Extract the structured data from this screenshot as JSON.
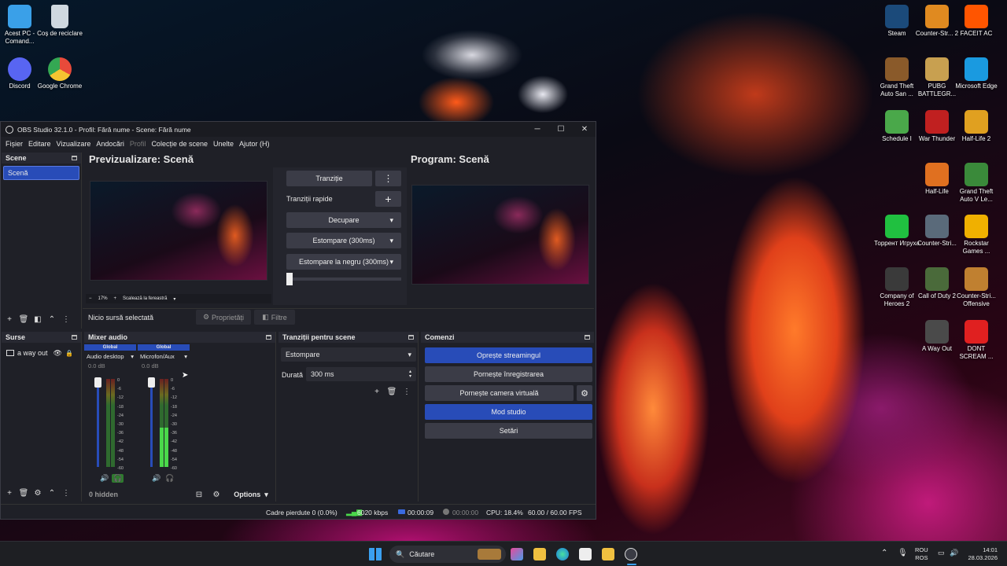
{
  "desktop": {
    "left_icons": [
      {
        "label": "Acest PC - Comand...",
        "icon": "monitor-icon",
        "color": "#3aa0e8"
      },
      {
        "label": "Coș de reciclare",
        "icon": "recycle-bin-icon",
        "color": "#cfd8e0"
      },
      {
        "label": "Discord",
        "icon": "discord-icon",
        "color": "#5865f2"
      },
      {
        "label": "Google Chrome",
        "icon": "chrome-icon",
        "color": "#e84a3a"
      }
    ],
    "right_icons": [
      {
        "label": "Steam",
        "icon": "steam-icon",
        "color": "#1b4a7a"
      },
      {
        "label": "Counter-Str... 2",
        "icon": "cs2-icon",
        "color": "#e08a20"
      },
      {
        "label": "FACEIT AC",
        "icon": "faceit-icon",
        "color": "#ff5500"
      },
      {
        "label": "Grand Theft Auto San ...",
        "icon": "gta-sa-icon",
        "color": "#8a5a2a"
      },
      {
        "label": "PUBG BATTLEGR...",
        "icon": "pubg-icon",
        "color": "#c8a050"
      },
      {
        "label": "Microsoft Edge",
        "icon": "edge-icon",
        "color": "#1a9ae0"
      },
      {
        "label": "Schedule I",
        "icon": "schedule-icon",
        "color": "#4aa84a"
      },
      {
        "label": "War Thunder",
        "icon": "war-thunder-icon",
        "color": "#c02020"
      },
      {
        "label": "Half-Life 2",
        "icon": "half-life-2-icon",
        "color": "#e0a020"
      },
      {
        "label": "Half-Life",
        "icon": "half-life-icon",
        "color": "#e07020"
      },
      {
        "label": "Grand Theft Auto V Le...",
        "icon": "gta-v-icon",
        "color": "#3a8a3a"
      },
      {
        "label": "Торрент Игруха",
        "icon": "torrent-icon",
        "color": "#20c040"
      },
      {
        "label": "Counter-Stri...",
        "icon": "cs-icon",
        "color": "#5a6a7a"
      },
      {
        "label": "Rockstar Games ...",
        "icon": "rockstar-icon",
        "color": "#f0b000"
      },
      {
        "label": "Company of Heroes 2",
        "icon": "coh2-icon",
        "color": "#3a3a3a"
      },
      {
        "label": "Call of Duty 2",
        "icon": "cod2-icon",
        "color": "#4a6a3a"
      },
      {
        "label": "Counter-Stri... Offensive",
        "icon": "csgo-icon",
        "color": "#c08030"
      },
      {
        "label": "A Way Out",
        "icon": "a-way-out-icon",
        "color": "#4a4a4a"
      },
      {
        "label": "DONT SCREAM ...",
        "icon": "dont-scream-icon",
        "color": "#e02020"
      }
    ]
  },
  "obs": {
    "title": "OBS Studio 32.1.0 - Profil: Fără nume - Scene: Fără nume",
    "menu": [
      "Fișier",
      "Editare",
      "Vizualizare",
      "Andocări",
      "Profil",
      "Colecție de scene",
      "Unelte",
      "Ajutor (H)"
    ],
    "scenes": {
      "title": "Scene",
      "items": [
        "Scenă"
      ]
    },
    "preview_title": "Previzualizare: Scenă",
    "program_title": "Program: Scenă",
    "zoom": {
      "minus": "−",
      "value": "17%",
      "plus": "+",
      "scale_label": "Scalează la fereastră"
    },
    "transitions_center": {
      "transition_btn": "Tranziție",
      "quick_label": "Tranziții rapide",
      "items": [
        "Decupare",
        "Estompare (300ms)",
        "Estompare la negru (300ms)"
      ]
    },
    "source_bar": {
      "none_selected": "Niciо sursă selectată",
      "properties": "Proprietăți",
      "filters": "Filtre"
    },
    "sources": {
      "title": "Surse",
      "items": [
        "a way out"
      ]
    },
    "mixer": {
      "title": "Mixer audio",
      "channels": [
        {
          "badge": "Global",
          "name": "Audio desktop",
          "db": "0.0 dB",
          "level": 0.0
        },
        {
          "badge": "Global",
          "name": "Microfon/Aux",
          "db": "0.0 dB",
          "level": 0.45
        }
      ],
      "ticks": [
        "0",
        "-6",
        "-12",
        "-18",
        "-24",
        "-30",
        "-36",
        "-42",
        "-48",
        "-54",
        "-60"
      ],
      "hidden": "0 hidden",
      "options": "Options"
    },
    "scene_transitions": {
      "title": "Tranziții pentru scene",
      "selected": "Estompare",
      "duration_label": "Durată",
      "duration_value": "300 ms"
    },
    "controls": {
      "title": "Comenzi",
      "buttons": [
        "Oprește streamingul",
        "Pornește înregistrarea",
        "Pornește camera virtuală",
        "Mod studio",
        "Setări"
      ]
    },
    "status": {
      "dropped": "Cadre pierdute 0 (0.0%)",
      "bitrate": "6020 kbps",
      "stream_time": "00:00:09",
      "rec_time": "00:00:00",
      "cpu": "CPU: 18.4%",
      "fps": "60.00 / 60.00 FPS"
    }
  },
  "taskbar": {
    "search": "Căutare",
    "lang1": "ROU",
    "lang2": "ROS",
    "time": "14:01",
    "date": "28.03.2026"
  }
}
